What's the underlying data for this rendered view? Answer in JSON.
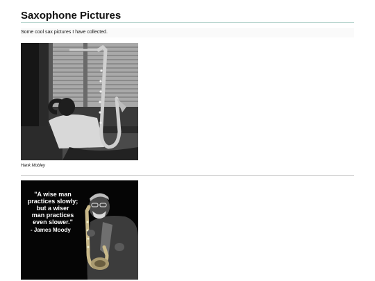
{
  "page": {
    "title": "Saxophone Pictures",
    "intro": "Some cool sax pictures I have collected."
  },
  "pictures": [
    {
      "caption": "Hank Mobley"
    },
    {
      "quote_lines": [
        "\"A wise man",
        "practices slowly;",
        "but a wiser",
        "man practices",
        "even slower.\""
      ],
      "quote_author": "- James Moody"
    }
  ]
}
